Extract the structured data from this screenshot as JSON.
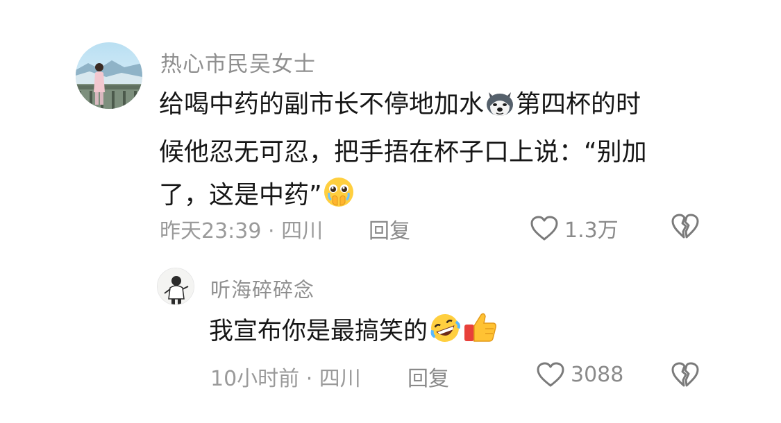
{
  "comment": {
    "username": "热心市民吴女士",
    "text_line1": "给喝中药的副市长不停地加水",
    "text_line1_after": "第四杯的时",
    "text_line2": "候他忍无可忍，把手捂在杯子口上说：“别加",
    "text_line3": "了，这是中药”",
    "emoji_1": "dog-face-emoji",
    "emoji_2": "pleading-face-emoji",
    "time_location": "昨天23:39 · 四川",
    "reply_label": "回复",
    "like_count": "1.3万"
  },
  "reply": {
    "username": "听海碎碎念",
    "text": "我宣布你是最搞笑的",
    "emoji_1": "rolling-laughing-emoji",
    "emoji_2": "thumbs-up-emoji",
    "time_location": "10小时前 · 四川",
    "reply_label": "回复",
    "like_count": "3088"
  }
}
